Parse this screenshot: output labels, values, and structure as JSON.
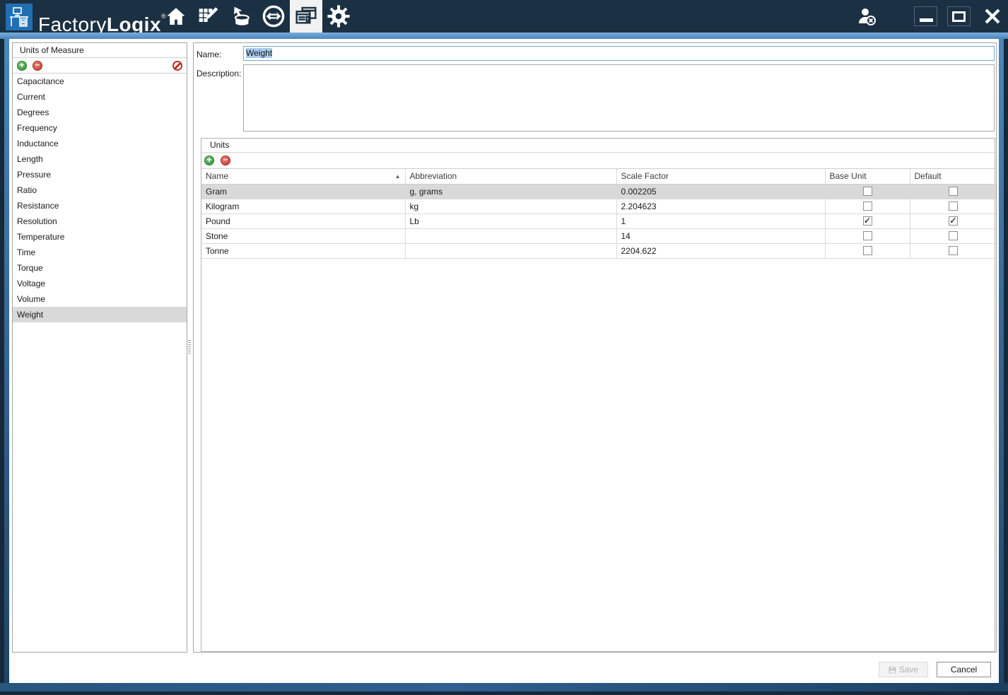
{
  "titlebar": {
    "brand_light": "Factory",
    "brand_bold": "Logix",
    "trademark": "®",
    "nav_icons": [
      "home-icon",
      "grid-pencil-icon",
      "database-import-icon",
      "sync-icon",
      "pages-icon",
      "gear-icon"
    ],
    "active_nav": "pages-icon",
    "window_controls": [
      "user-logout-icon",
      "minimize",
      "maximize",
      "close"
    ]
  },
  "sidebar": {
    "title": "Units of Measure",
    "toolbar_icons": [
      "add-icon",
      "remove-icon",
      "no-edit-icon"
    ],
    "items": [
      "Capacitance",
      "Current",
      "Degrees",
      "Frequency",
      "Inductance",
      "Length",
      "Pressure",
      "Ratio",
      "Resistance",
      "Resolution",
      "Temperature",
      "Time",
      "Torque",
      "Voltage",
      "Volume",
      "Weight"
    ],
    "selected_item": "Weight"
  },
  "form": {
    "name_label": "Name:",
    "name_value": "Weight",
    "description_label": "Description:",
    "description_value": ""
  },
  "units": {
    "title": "Units",
    "toolbar_icons": [
      "add-icon",
      "remove-icon"
    ],
    "columns": [
      "Name",
      "Abbreviation",
      "Scale Factor",
      "Base Unit",
      "Default"
    ],
    "sort": {
      "column": "Name",
      "direction": "ascending"
    },
    "rows": [
      {
        "name": "Gram",
        "abbreviation": "g, grams",
        "scale_factor": "0.002205",
        "base_unit": false,
        "default": false
      },
      {
        "name": "Kilogram",
        "abbreviation": "kg",
        "scale_factor": "2.204623",
        "base_unit": false,
        "default": false
      },
      {
        "name": "Pound",
        "abbreviation": "Lb",
        "scale_factor": "1",
        "base_unit": true,
        "default": true
      },
      {
        "name": "Stone",
        "abbreviation": "",
        "scale_factor": "14",
        "base_unit": false,
        "default": false
      },
      {
        "name": "Tonne",
        "abbreviation": "",
        "scale_factor": "2204.622",
        "base_unit": false,
        "default": false
      }
    ],
    "selected_row": "Gram"
  },
  "footer": {
    "save_label": "Save",
    "cancel_label": "Cancel"
  },
  "colors": {
    "chrome_navy": "#1b3042",
    "frame_blue": "#4c86b9",
    "logo_blue": "#1f6fb4",
    "selection_blue": "#a8ccee",
    "row_selected_gray": "#d9d9d9",
    "add_green": "#2e8b33",
    "remove_red": "#c0392b"
  }
}
